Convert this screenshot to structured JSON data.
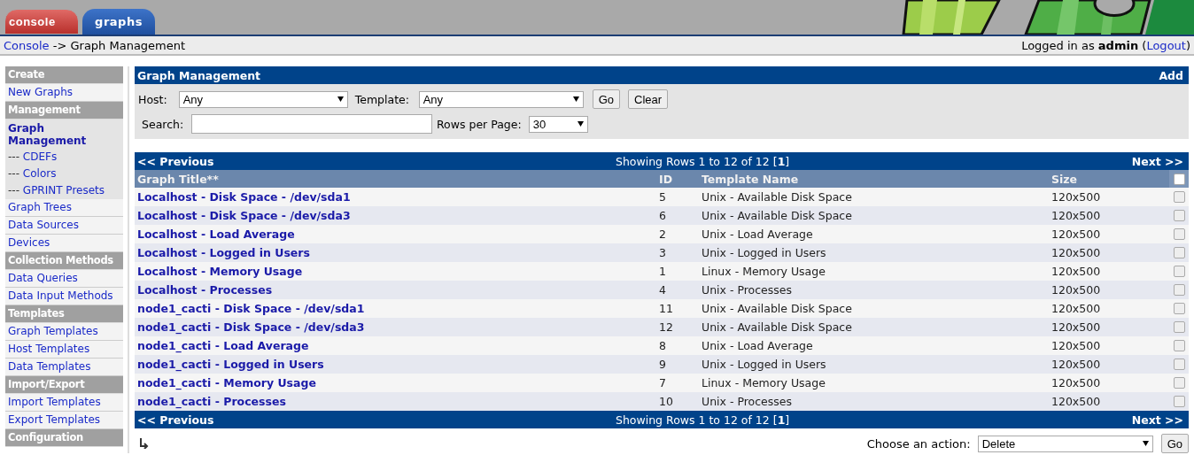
{
  "tabs": [
    {
      "label": "console",
      "selected": true
    },
    {
      "label": "graphs",
      "selected": false
    }
  ],
  "breadcrumb": {
    "link": "Console",
    "rest": "-> Graph Management"
  },
  "login": {
    "text": "Logged in as **admin** (",
    "link": "Logout",
    "after": ")"
  },
  "sidebar": [
    {
      "kind": "header",
      "label": "Create"
    },
    {
      "kind": "item",
      "label": "New Graphs",
      "selected": false
    },
    {
      "kind": "header",
      "label": "Management"
    },
    {
      "kind": "item",
      "label": "Graph Management",
      "selected": true,
      "children": [
        {
          "prefix": "---",
          "label": "CDEFs"
        },
        {
          "prefix": "---",
          "label": "Colors"
        },
        {
          "prefix": "---",
          "label": "GPRINT Presets"
        }
      ]
    },
    {
      "kind": "item",
      "label": "Graph Trees",
      "selected": false
    },
    {
      "kind": "item",
      "label": "Data Sources",
      "selected": false
    },
    {
      "kind": "item",
      "label": "Devices",
      "selected": false
    },
    {
      "kind": "header",
      "label": "Collection Methods"
    },
    {
      "kind": "item",
      "label": "Data Queries",
      "selected": false
    },
    {
      "kind": "item",
      "label": "Data Input Methods",
      "selected": false
    },
    {
      "kind": "header",
      "label": "Templates"
    },
    {
      "kind": "item",
      "label": "Graph Templates",
      "selected": false
    },
    {
      "kind": "item",
      "label": "Host Templates",
      "selected": false
    },
    {
      "kind": "item",
      "label": "Data Templates",
      "selected": false
    },
    {
      "kind": "header",
      "label": "Import/Export"
    },
    {
      "kind": "item",
      "label": "Import Templates",
      "selected": false
    },
    {
      "kind": "item",
      "label": "Export Templates",
      "selected": false
    },
    {
      "kind": "header",
      "label": "Configuration"
    }
  ],
  "panel": {
    "title": "Graph Management",
    "add": "Add"
  },
  "filter": {
    "host_label": "Host:",
    "host_value": "Any",
    "template_label": "Template:",
    "template_value": "Any",
    "go": "Go",
    "clear": "Clear",
    "search_label": "Search:",
    "rows_label": "Rows per Page:",
    "rows_value": "30"
  },
  "nav_top": {
    "previous": "<< Previous",
    "showing": "Showing Rows 1 to 12 of 12 [**1**]",
    "next": "Next >>"
  },
  "nav_bottom": {
    "previous": "<< Previous",
    "showing": "Showing Rows 1 to 12 of 12 [**1**]",
    "next": "Next >>"
  },
  "table": {
    "columns": [
      "Graph Title**",
      "ID",
      "Template Name",
      "Size"
    ],
    "select_all_checked": false,
    "rows": [
      {
        "title": "Localhost - Disk Space - /dev/sda1",
        "id": "5",
        "template": "Unix - Available Disk Space",
        "size": "120x500",
        "checked": false
      },
      {
        "title": "Localhost - Disk Space - /dev/sda3",
        "id": "6",
        "template": "Unix - Available Disk Space",
        "size": "120x500",
        "checked": false
      },
      {
        "title": "Localhost - Load Average",
        "id": "2",
        "template": "Unix - Load Average",
        "size": "120x500",
        "checked": false
      },
      {
        "title": "Localhost - Logged in Users",
        "id": "3",
        "template": "Unix - Logged in Users",
        "size": "120x500",
        "checked": false
      },
      {
        "title": "Localhost - Memory Usage",
        "id": "1",
        "template": "Linux - Memory Usage",
        "size": "120x500",
        "checked": false
      },
      {
        "title": "Localhost - Processes",
        "id": "4",
        "template": "Unix - Processes",
        "size": "120x500",
        "checked": false
      },
      {
        "title": "node1_cacti - Disk Space - /dev/sda1",
        "id": "11",
        "template": "Unix - Available Disk Space",
        "size": "120x500",
        "checked": false
      },
      {
        "title": "node1_cacti - Disk Space - /dev/sda3",
        "id": "12",
        "template": "Unix - Available Disk Space",
        "size": "120x500",
        "checked": false
      },
      {
        "title": "node1_cacti - Load Average",
        "id": "8",
        "template": "Unix - Load Average",
        "size": "120x500",
        "checked": false
      },
      {
        "title": "node1_cacti - Logged in Users",
        "id": "9",
        "template": "Unix - Logged in Users",
        "size": "120x500",
        "checked": false
      },
      {
        "title": "node1_cacti - Memory Usage",
        "id": "7",
        "template": "Linux - Memory Usage",
        "size": "120x500",
        "checked": false
      },
      {
        "title": "node1_cacti - Processes",
        "id": "10",
        "template": "Unix - Processes",
        "size": "120x500",
        "checked": false
      }
    ]
  },
  "action": {
    "label": "Choose an action:",
    "value": "Delete",
    "go": "Go"
  }
}
